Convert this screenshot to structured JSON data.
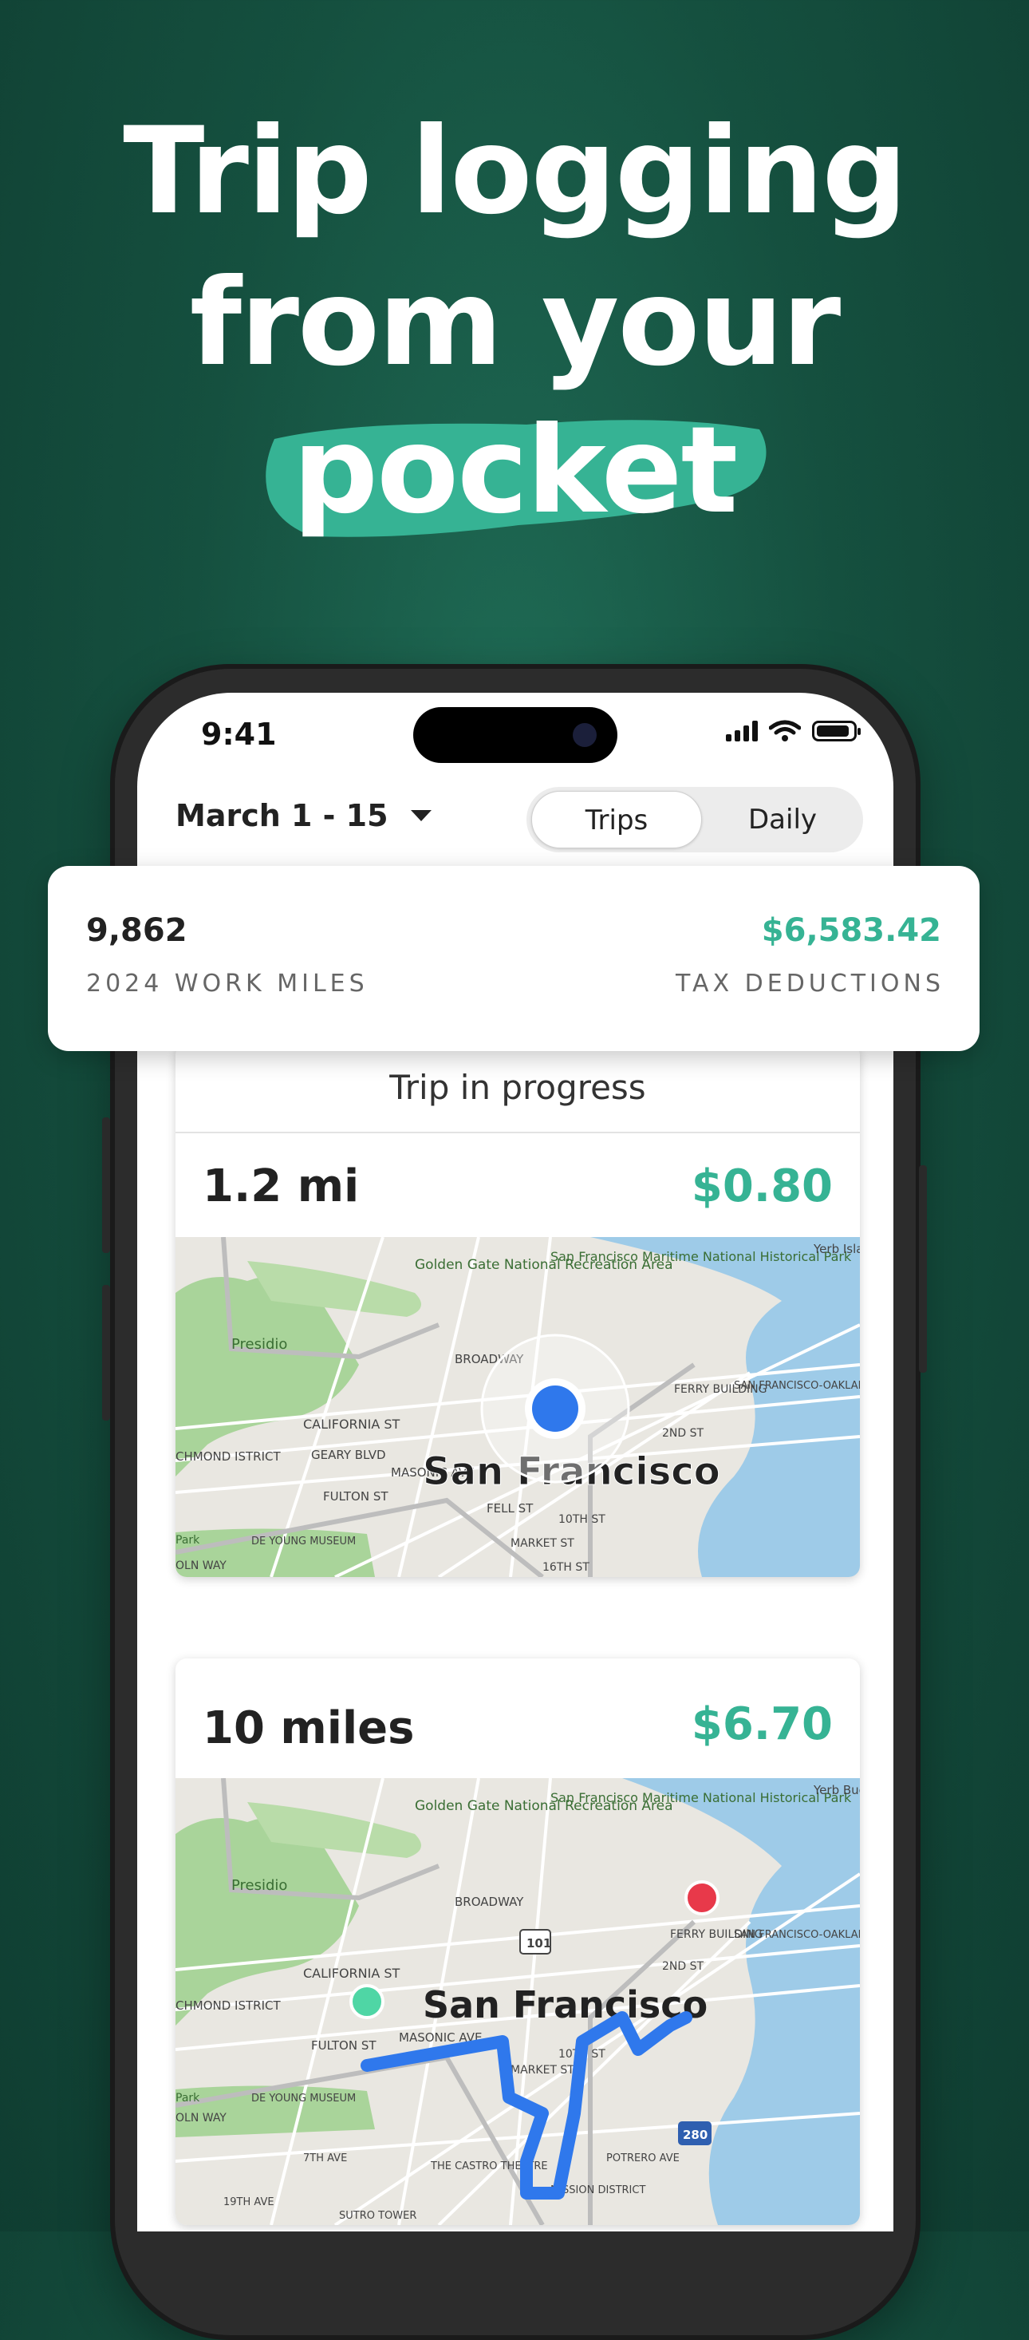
{
  "headline": {
    "line1": "Trip logging",
    "line2": "from your",
    "line3": "pocket"
  },
  "colors": {
    "accent": "#36b394",
    "background": "#15503f"
  },
  "status_bar": {
    "time": "9:41",
    "icons": [
      "signal-icon",
      "wifi-icon",
      "battery-icon"
    ]
  },
  "header": {
    "date_range": "March 1 - 15",
    "segments": [
      {
        "label": "Trips",
        "selected": true
      },
      {
        "label": "Daily",
        "selected": false
      }
    ]
  },
  "stats": {
    "miles_value": "9,862",
    "miles_label": "2024 WORK MILES",
    "deductions_value": "$6,583.42",
    "deductions_label": "TAX DEDUCTIONS"
  },
  "trips": [
    {
      "banner": "Trip in progress",
      "distance": "1.2 mi",
      "amount": "$0.80",
      "map_labels": {
        "city": "San Francisco",
        "golden_gate": "Golden Gate National Recreation Area",
        "maritime": "San Francisco Maritime National Historical Park",
        "presidio": "Presidio",
        "broadway": "BROADWAY",
        "california": "CALIFORNIA ST",
        "geary": "GEARY BLVD",
        "fulton": "FULTON ST",
        "fell": "FELL ST",
        "masonic": "MASONIC AVE",
        "market": "MARKET ST",
        "tenth": "10TH ST",
        "sixteenth": "16TH ST",
        "second": "2ND ST",
        "ferry": "FERRY BUILDING",
        "bridge": "SAN FRANCISCO-OAKLAND BAY BRIDGE",
        "deyoung": "DE YOUNG MUSEUM",
        "richmond": "CHMOND ISTRICT",
        "yerba": "Yerb Islan",
        "lincoln": "OLN WAY",
        "park": "Park"
      }
    },
    {
      "distance": "10 miles",
      "amount": "$6.70",
      "map_labels": {
        "city": "San Francisco",
        "golden_gate": "Golden Gate National Recreation Area",
        "maritime": "San Francisco Maritime National Historical Park",
        "presidio": "Presidio",
        "broadway": "BROADWAY",
        "california": "CALIFORNIA ST",
        "fulton": "FULTON ST",
        "masonic": "MASONIC AVE",
        "market": "MARKET ST",
        "tenth": "10TH ST",
        "second": "2ND ST",
        "ferry": "FERRY BUILDING",
        "bridge": "SAN FRANCISCO-OAKLAND BAY BRIDGE",
        "deyoung": "DE YOUNG MUSEUM",
        "richmond": "CHMOND ISTRICT",
        "castro": "THE CASTRO THEATRE",
        "mission": "MISSION DISTRICT",
        "potrero": "POTRERO AVE",
        "seventh": "7TH AVE",
        "nineteenth": "19TH AVE",
        "sutro": "SUTRO TOWER",
        "hw101": "101",
        "hw280": "280",
        "lincoln": "OLN WAY",
        "park": "Park",
        "yerba": "Yerb Buer Islan"
      }
    }
  ]
}
